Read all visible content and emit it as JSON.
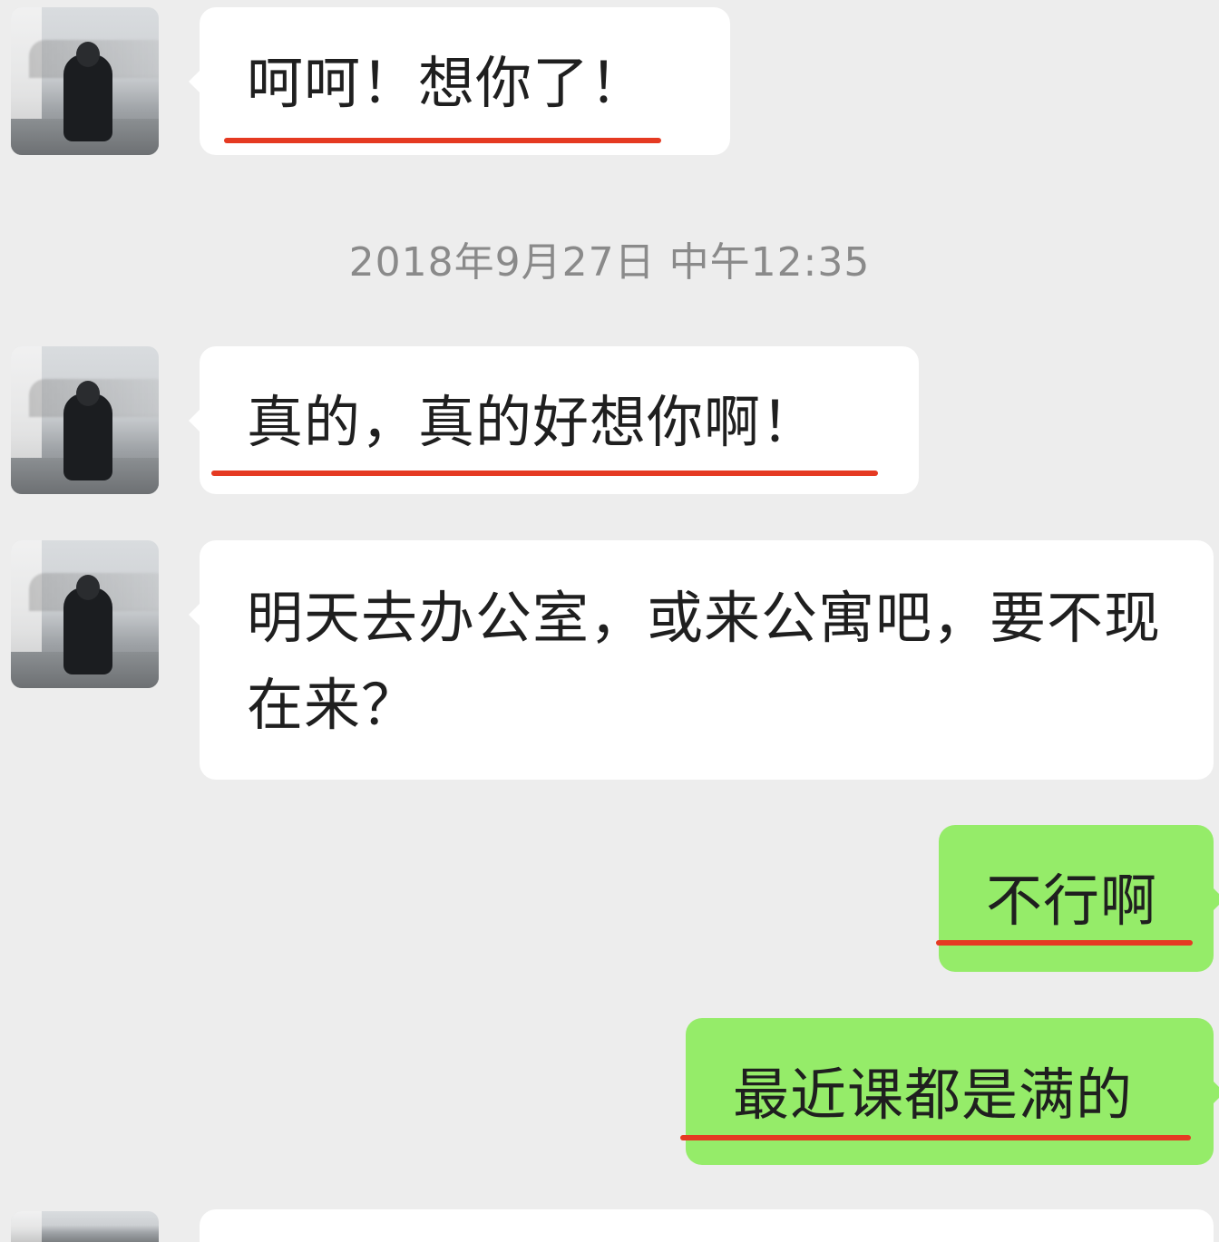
{
  "chat": {
    "timestamp": "2018年9月27日 中午12:35",
    "messages": [
      {
        "from": "other",
        "text": "呵呵！想你了！",
        "underlined": true
      },
      {
        "from": "other",
        "text": "真的，真的好想你啊！",
        "underlined": true
      },
      {
        "from": "other",
        "text": "明天去办公室，或来公寓吧，要不现在来？",
        "underlined": false
      },
      {
        "from": "self",
        "text": "不行啊",
        "underlined": true
      },
      {
        "from": "self",
        "text": "最近课都是满的",
        "underlined": true
      }
    ]
  },
  "colors": {
    "background": "#EDEDED",
    "incoming_bubble": "#FFFFFF",
    "outgoing_bubble": "#95EC69",
    "underline": "#E53A22",
    "timestamp_text": "#8A8A8A"
  }
}
